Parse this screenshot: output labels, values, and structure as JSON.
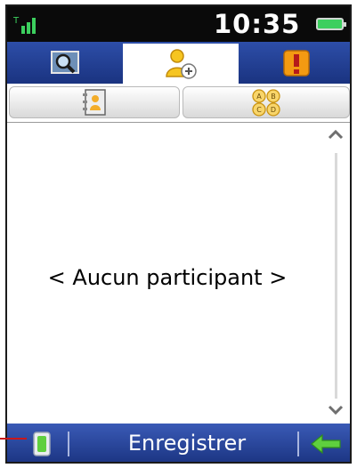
{
  "status_bar": {
    "time": "10:35",
    "signal_icon": "signal-icon",
    "battery_icon": "battery-icon"
  },
  "tabs": [
    {
      "icon": "search-icon",
      "active": false
    },
    {
      "icon": "add-participant-icon",
      "active": true
    },
    {
      "icon": "alert-icon",
      "active": false
    }
  ],
  "sub_toolbar": [
    {
      "icon": "contact-book-icon"
    },
    {
      "icon": "abcd-icon",
      "glyphs": [
        "A",
        "B",
        "C",
        "D"
      ]
    }
  ],
  "content": {
    "empty_text": "< Aucun participant >"
  },
  "bottom_bar": {
    "save_label": "Enregistrer",
    "left_icon": "menu-icon",
    "back_icon": "back-arrow-icon"
  },
  "colors": {
    "bar_blue": "#1a3380",
    "green_icon": "#5fcf3e",
    "alert_orange": "#f39a12",
    "pointer_red": "#c8171b"
  }
}
